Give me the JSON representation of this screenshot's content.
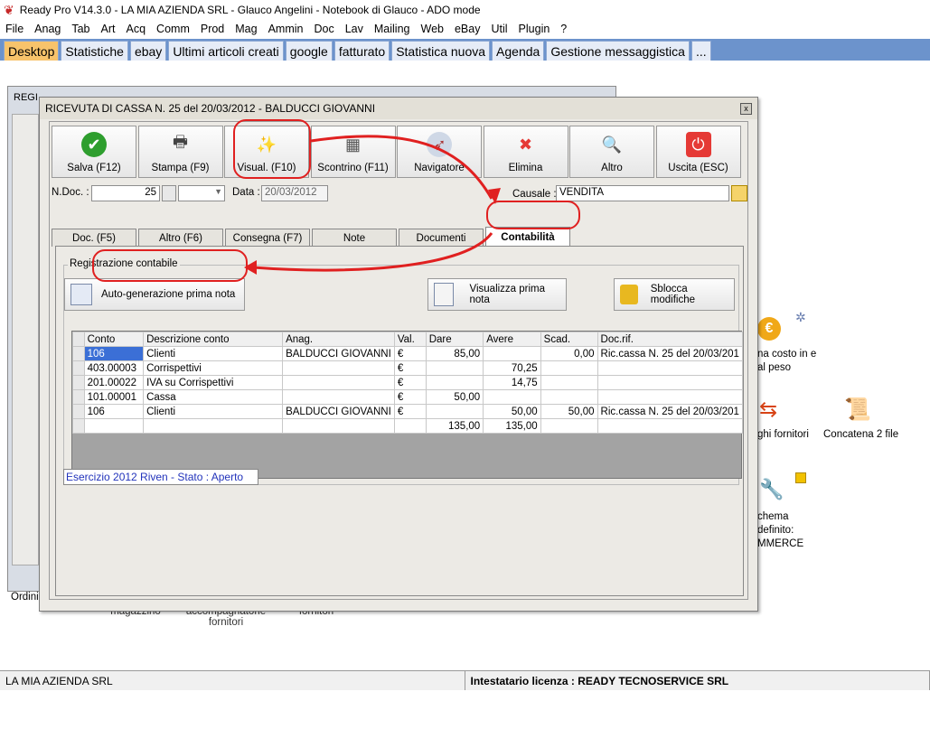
{
  "app": {
    "title": "Ready Pro V14.3.0 - LA MIA AZIENDA SRL - Glauco Angelini - Notebook di Glauco - ADO mode"
  },
  "menu": [
    "File",
    "Anag",
    "Tab",
    "Art",
    "Acq",
    "Comm",
    "Prod",
    "Mag",
    "Ammin",
    "Doc",
    "Lav",
    "Mailing",
    "Web",
    "eBay",
    "Util",
    "Plugin",
    "?"
  ],
  "tabs": [
    "Desktop",
    "Statistiche",
    "ebay",
    "Ultimi articoli creati",
    "google",
    "fatturato",
    "Statistica nuova",
    "Agenda",
    "Gestione messaggistica",
    "..."
  ],
  "background": {
    "win_title": "REGI",
    "left_label": "Ordini",
    "labels_bottom": [
      "magazzino",
      "accompagnatorie fornitori",
      "fornitori"
    ]
  },
  "desktop_icons": {
    "costo": "na costo in e al peso",
    "fornitori": "ghi fornitori",
    "concatena": "Concatena 2 file",
    "schema": "chema definito: MMERCE"
  },
  "dialog": {
    "title": "RICEVUTA DI CASSA N. 25  del 20/03/2012 - BALDUCCI GIOVANNI",
    "close": "x",
    "toolbar": [
      {
        "label": "Salva (F12)",
        "icon": "check-icon"
      },
      {
        "label": "Stampa (F9)",
        "icon": "printer-icon"
      },
      {
        "label": "Visual. (F10)",
        "icon": "magic-wand-icon"
      },
      {
        "label": "Scontrino (F11)",
        "icon": "cash-register-icon"
      },
      {
        "label": "Navigatore",
        "icon": "compass-icon"
      },
      {
        "label": "Elimina",
        "icon": "x-icon"
      },
      {
        "label": "Altro",
        "icon": "magnifier-icon"
      },
      {
        "label": "Uscita (ESC)",
        "icon": "power-icon"
      }
    ],
    "ndoc_label": "N.Doc. :",
    "ndoc_value": "25",
    "data_label": "Data :",
    "data_value": "20/03/2012",
    "causale_label": "Causale :",
    "causale_value": "VENDITA",
    "tabs": [
      "Doc. (F5)",
      "Altro (F6)",
      "Consegna (F7)",
      "Note",
      "Documenti",
      "Contabilità"
    ],
    "group_title": "Registrazione contabile",
    "btn_auto": "Auto-generazione prima nota",
    "btn_visualizza": "Visualizza prima nota",
    "btn_sblocca": "Sblocca modifiche",
    "grid": {
      "headers": [
        "Conto",
        "Descrizione conto",
        "Anag.",
        "Val.",
        "Dare",
        "Avere",
        "Scad.",
        "Doc.rif."
      ],
      "rows": [
        [
          "106",
          "Clienti",
          "BALDUCCI GIOVANNI",
          "€",
          "85,00",
          "",
          "0,00",
          "Ric.cassa N. 25 del 20/03/201"
        ],
        [
          "403.00003",
          "Corrispettivi",
          "",
          "€",
          "",
          "70,25",
          "",
          ""
        ],
        [
          "201.00022",
          "IVA su Corrispettivi",
          "",
          "€",
          "",
          "14,75",
          "",
          ""
        ],
        [
          "101.00001",
          "Cassa",
          "",
          "€",
          "50,00",
          "",
          "",
          ""
        ],
        [
          "106",
          "Clienti",
          "BALDUCCI GIOVANNI",
          "€",
          "",
          "50,00",
          "50,00",
          "Ric.cassa N. 25 del 20/03/201"
        ],
        [
          "",
          "",
          "",
          "",
          "135,00",
          "135,00",
          "",
          ""
        ]
      ]
    },
    "esercizio": "Esercizio 2012 Riven - Stato : Aperto"
  },
  "status": {
    "left": "LA MIA AZIENDA SRL",
    "right": "Intestatario licenza : READY TECNOSERVICE SRL"
  }
}
